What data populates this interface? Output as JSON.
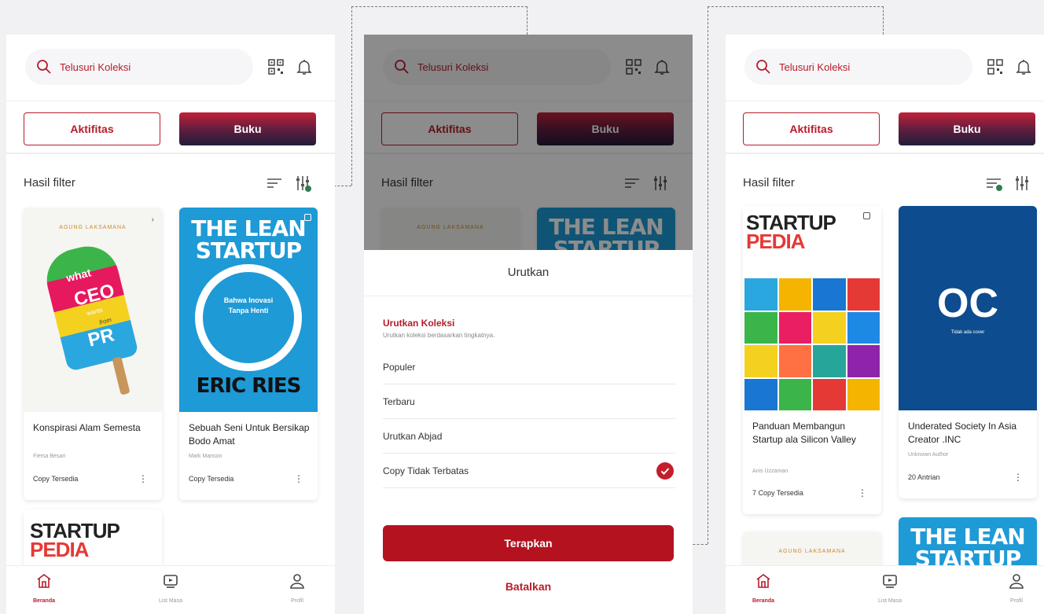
{
  "search": {
    "placeholder": "Telusuri Koleksi"
  },
  "tabs": {
    "activity": "Aktifitas",
    "book": "Buku"
  },
  "filter": {
    "title": "Hasil filter"
  },
  "screen1": {
    "books": [
      {
        "title": "Konspirasi Alam Semesta",
        "author": "Fiersa Besari",
        "status": "Copy Tersedia",
        "cover_top": "AGUNG LAKSAMANA",
        "cover_words": [
          "what",
          "CEO",
          "wants",
          "from",
          "PR"
        ]
      },
      {
        "title": "Sebuah Seni Untuk Bersikap Bodo Amat",
        "author": "Mark Manson",
        "status": "Copy Tersedia",
        "cover_t1": "THE LEAN",
        "cover_t2": "STARTUP",
        "cover_mid": "Bahwa Inovasi Tanpa Henti",
        "cover_author": "ERIC RIES"
      }
    ],
    "peek": {
      "t1": "STARTUP",
      "t2": "PEDIA"
    }
  },
  "sheet": {
    "title": "Urutkan",
    "section_title": "Urutkan Koleksi",
    "section_sub": "Urutkan koleksi berdasarkan tingkatnya.",
    "options": [
      "Populer",
      "Terbaru",
      "Urutkan Abjad",
      "Copy Tidak Terbatas"
    ],
    "selected_index": 3,
    "apply": "Terapkan",
    "cancel": "Batalkan"
  },
  "screen2": {
    "peek_left": "AGUNG LAKSAMANA",
    "peek_t1": "THE LEAN",
    "peek_t2": "STARTUP"
  },
  "screen3": {
    "books": [
      {
        "title": "Panduan Membangun Startup ala Silicon Valley",
        "author": "Anis Uzzaman",
        "status": "7 Copy Tersedia",
        "cover_t1": "STARTUP",
        "cover_t2": "PEDIA"
      },
      {
        "title": "Underated Society In Asia Creator .INC",
        "author": "Unknown Author",
        "status": "20 Antrian",
        "cover_logo": "OC",
        "cover_note": "Tidak ada cover"
      }
    ],
    "peek_left": "AGUNG LAKSAMANA",
    "peek_t1": "THE LEAN",
    "peek_t2": "STARTUP"
  },
  "nav": {
    "home": "Beranda",
    "mymedia": "List Masa",
    "profile": "Profil"
  },
  "colors": {
    "brand": "#b71c2b",
    "apply": "#b5121f",
    "tab_gradient_end": "#221c3a",
    "lean_blue": "#1e9ad6",
    "navy": "#0d4c8f"
  }
}
